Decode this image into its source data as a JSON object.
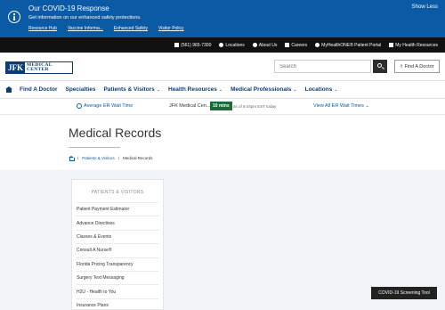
{
  "covid_banner": {
    "title": "Our COVID-19 Response",
    "description": "Get information on our enhanced safety protections.",
    "links": [
      "Resource Hub",
      "Vaccine Informa...",
      "Enhanced Safety",
      "Visitor Policy"
    ],
    "toggle_label": "Show Less",
    "icon": "info-icon",
    "background_color": "#0b5aa6"
  },
  "utility_bar": {
    "items": [
      {
        "label": "(561) 965-7300",
        "icon": "phone-icon"
      },
      {
        "label": "Locations",
        "icon": "location-icon"
      },
      {
        "label": "About Us",
        "icon": "info-icon"
      },
      {
        "label": "Careers",
        "icon": "briefcase-icon"
      },
      {
        "label": "MyHealthONE® Patient Portal",
        "icon": "star-icon"
      },
      {
        "label": "My Health Resources",
        "icon": "list-icon"
      }
    ]
  },
  "brand": {
    "logo_short": "JFK",
    "logo_line1": "MEDICAL",
    "logo_line2": "CENTER",
    "brand_color": "#0b3c78"
  },
  "search": {
    "placeholder": "Search",
    "find_doctor_label": "Find A Doctor"
  },
  "nav": {
    "items": [
      {
        "label": "Find A Doctor",
        "has_dropdown": false
      },
      {
        "label": "Specialties",
        "has_dropdown": false
      },
      {
        "label": "Patients & Visitors",
        "has_dropdown": true
      },
      {
        "label": "Health Resources",
        "has_dropdown": true
      },
      {
        "label": "Medical Professionals",
        "has_dropdown": true
      },
      {
        "label": "Locations",
        "has_dropdown": true
      }
    ]
  },
  "er_wait": {
    "label": "Average ER Wait Time",
    "facility": "JFK Medical Cen...",
    "wait": "10 mins",
    "as_of": "as of 9:44pm EST today",
    "view_all": "View All ER Wait Times",
    "badge_color": "#1a6b3a"
  },
  "page": {
    "title": "Medical Records",
    "breadcrumb": {
      "parent": "Patients & Visitors",
      "current": "Medical Records",
      "separator": "/"
    }
  },
  "side_menu": {
    "heading": "PATIENTS & VISITORS",
    "items": [
      "Patient Payment Estimator",
      "Advance Directives",
      "Classes & Events",
      "Consult A Nurse®",
      "Florida Pricing Transparency",
      "Surgery Text Messaging",
      "H2U - Health to You",
      "Insurance Plans"
    ]
  },
  "floating": {
    "covid_tool_label": "COVID-19 Screening Tool"
  }
}
